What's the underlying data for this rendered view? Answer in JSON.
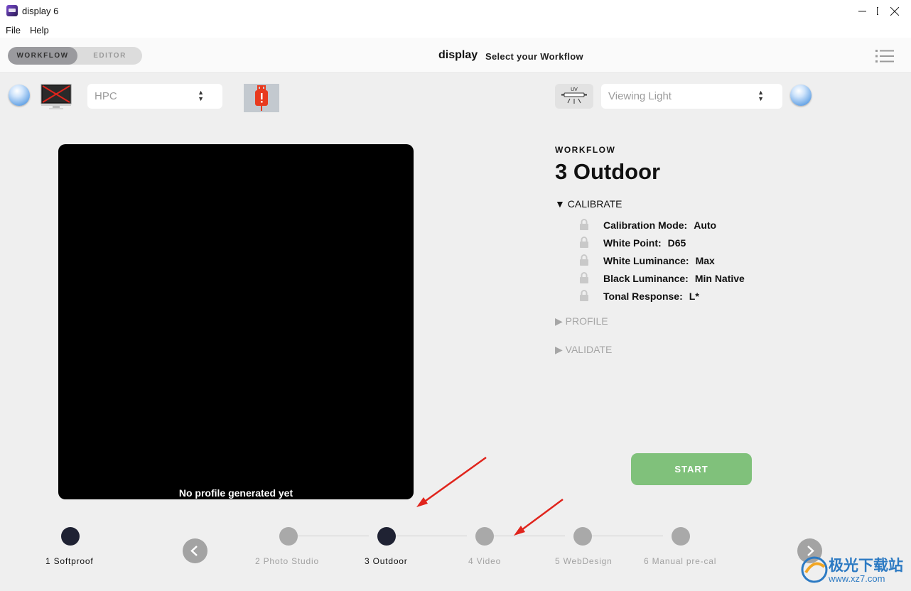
{
  "window": {
    "title": "display 6",
    "minimize_icon": "minimize-icon",
    "maximize_icon": "maximize-icon",
    "close_icon": "close-icon"
  },
  "menubar": {
    "items": [
      "File",
      "Help"
    ]
  },
  "header": {
    "modes": [
      "WORKFLOW",
      "EDITOR"
    ],
    "active_mode": "WORKFLOW",
    "brand": "display",
    "subtitle": "Select your Workflow",
    "menu_icon": "hamburger-menu-icon"
  },
  "devices": {
    "display_select": {
      "value": "HPC"
    },
    "viewing_light_select": {
      "placeholder": "Viewing Light"
    },
    "uv_label": "UV",
    "usb_status_color": "#e83a1e"
  },
  "preview": {
    "label": "No profile generated yet"
  },
  "workflow": {
    "heading": "WORKFLOW",
    "name": "3 Outdoor",
    "sections": {
      "calibrate": "CALIBRATE",
      "profile": "PROFILE",
      "validate": "VALIDATE"
    },
    "settings": [
      {
        "label": "Calibration Mode:",
        "value": "Auto"
      },
      {
        "label": "White Point:",
        "value": "D65"
      },
      {
        "label": "White Luminance:",
        "value": "Max"
      },
      {
        "label": "Black Luminance:",
        "value": "Min Native"
      },
      {
        "label": "Tonal Response:",
        "value": "L*"
      }
    ],
    "start_label": "START",
    "start_color": "#80c17b"
  },
  "steps": [
    {
      "label": "1 Softproof",
      "state": "done"
    },
    {
      "label": "2 Photo Studio",
      "state": "inactive"
    },
    {
      "label": "3 Outdoor",
      "state": "active"
    },
    {
      "label": "4 Video",
      "state": "inactive"
    },
    {
      "label": "5 WebDesign",
      "state": "inactive"
    },
    {
      "label": "6 Manual pre-cal",
      "state": "inactive"
    }
  ],
  "watermark": {
    "text": "极光下载站",
    "url": "www.xz7.com"
  }
}
